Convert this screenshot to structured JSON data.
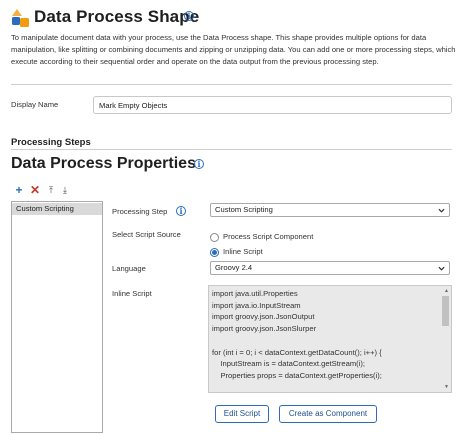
{
  "header": {
    "title": "Data Process Shape",
    "description": "To manipulate document data with your process, use the Data Process shape. This shape provides multiple options for data manipulation, like splitting or combining documents and zipping or unzipping data. You can add one or more processing steps, which execute according to their sequential order and operate on the data output from the previous processing step."
  },
  "display_name": {
    "label": "Display Name",
    "value": "Mark Empty Objects"
  },
  "processing_steps": {
    "section_title": "Processing Steps",
    "props_title": "Data Process Properties",
    "toolbar": {
      "add": "+",
      "delete": "✕",
      "move_up": "⤒",
      "move_down": "⤓"
    },
    "items": [
      "Custom Scripting"
    ]
  },
  "form": {
    "processing_step_label": "Processing Step",
    "processing_step_value": "Custom Scripting",
    "script_source_label": "Select Script Source",
    "script_source_options": [
      "Process Script Component",
      "Inline Script"
    ],
    "script_source_selected": "Inline Script",
    "language_label": "Language",
    "language_value": "Groovy 2.4",
    "inline_script_label": "Inline Script",
    "inline_script": "import java.util.Properties\nimport java.io.InputStream\nimport groovy.json.JsonOutput\nimport groovy.json.JsonSlurper\n\nfor (int i = 0; i < dataContext.getDataCount(); i++) {\n    InputStream is = dataContext.getStream(i);\n    Properties props = dataContext.getProperties(i);",
    "edit_script_button": "Edit Script",
    "create_component_button": "Create as Component"
  },
  "colors": {
    "accent": "#2a6ebb",
    "delete": "#c0392b",
    "selected_item": "#d9d9d9",
    "code_bg": "#e9e9e9"
  },
  "icons": [
    "data-process-logo-icon",
    "info-icon",
    "add-icon",
    "delete-icon",
    "move-top-icon",
    "move-bottom-icon",
    "chevron-down-icon"
  ]
}
